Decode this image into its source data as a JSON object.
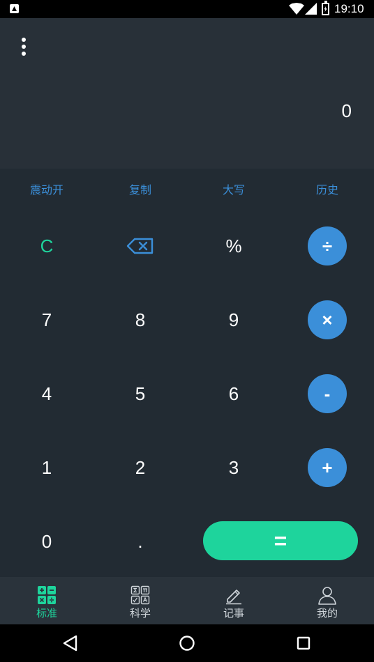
{
  "status_bar": {
    "time": "19:10"
  },
  "display": {
    "value": "0"
  },
  "function_row": [
    "震动开",
    "复制",
    "大写",
    "历史"
  ],
  "keys": {
    "clear": "C",
    "percent": "%",
    "divide": "÷",
    "multiply": "×",
    "minus": "-",
    "plus": "+",
    "equals": "=",
    "digits": [
      "7",
      "8",
      "9",
      "4",
      "5",
      "6",
      "1",
      "2",
      "3",
      "0",
      "."
    ]
  },
  "tabs": [
    {
      "label": "标准",
      "icon": "standard-calculator-icon",
      "active": true
    },
    {
      "label": "科学",
      "icon": "scientific-calculator-icon",
      "active": false
    },
    {
      "label": "记事",
      "icon": "notes-edit-icon",
      "active": false
    },
    {
      "label": "我的",
      "icon": "profile-icon",
      "active": false
    }
  ],
  "colors": {
    "accent_blue": "#3b8fd9",
    "accent_green": "#1ed49c",
    "display_bg": "#283038",
    "keypad_bg": "#222b33"
  }
}
